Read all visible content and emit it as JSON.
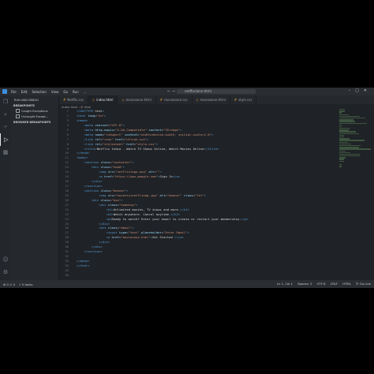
{
  "titlebar": {
    "menu": [
      "File",
      "Edit",
      "Selection",
      "View",
      "Go",
      "Run",
      "…"
    ],
    "search": "netflixclone-html"
  },
  "sidebar": {
    "title": "RUN AND DEBUG",
    "breakpoints_header": "BREAKPOINTS",
    "items": [
      "Caught Exceptions",
      "Uncaught Except…"
    ],
    "loaded_header": "BROWSER BREAKPOINTS"
  },
  "tabs": [
    {
      "label": "Netflix.css",
      "active": false
    },
    {
      "label": "index.html",
      "active": true
    },
    {
      "label": "moviezone.html",
      "active": false
    },
    {
      "label": "moviezone.css",
      "active": false
    },
    {
      "label": "moviezone.html",
      "active": false
    },
    {
      "label": "style.css",
      "active": false
    }
  ],
  "breadcrumb": "index.html › ⊘ html",
  "code": {
    "start_line": 1,
    "lines": [
      "<!DOCTYPE html>",
      "<html lang=\"en\">",
      "<head>",
      "    <meta charset=\"UTF-8\">",
      "    <meta http-equiv=\"X-UA-Compatible\" content=\"IE=edge\">",
      "    <meta name=\"viewport\" content=\"width=device-width, initial-scale=1.0\">",
      "    <link rel=\"icon\" href=\"ntlcon.ico\">",
      "    <link rel=\"stylesheet\" href=\"style.css\">",
      "    <title>Netflix India - Watch TV Shows Online, Watch Movies Online</title>",
      "</head>",
      "<body>",
      "    <section class=\"container\">",
      "        <div class=\"head\">",
      "            <img src=\"netflixlogo.png\" alt=\"\">",
      "            <a href=\"https://www.google.com\">Sign In</a>",
      "        </div>",
      "    </section>",
      "    <section class=\"banner\">",
      "            <img src=\"assests/netflixbg.jpg\" alt=\"banner\" class=\"fit\">",
      "        <div class=\"box\">",
      "            <div class=\"heading\">",
      "                <h1>Unlimited movies, TV shows and more.</h1>",
      "                <h2>Watch anywhere. Cancel anytime.</h2>",
      "                <p>Ready to watch? Enter your email to create or restart your membership.</p>",
      "            </div>",
      "            <div class=\"email\">",
      "                <input type=\"text\" placeholder=\"Enter Email\">",
      "                <a href=\"moviezone.html\">Get Started ></a>",
      "            </div>",
      "        </div>",
      "    </section>",
      "",
      "</body>",
      "</html>",
      "",
      ""
    ]
  },
  "statusbar": {
    "left": [
      "⊗ 0  ⚠ 0",
      "⚡ 0 tasks"
    ],
    "right": [
      "Ln 1, Col 1",
      "Spaces: 2",
      "UTF-8",
      "CRLF",
      "HTML",
      "⦿ Go Live"
    ]
  },
  "colors": {
    "editor_bg": "#1f2226",
    "tag": "#569cd6",
    "attr": "#9cdcfe",
    "string": "#ce9178",
    "text": "#d4d4d4"
  }
}
